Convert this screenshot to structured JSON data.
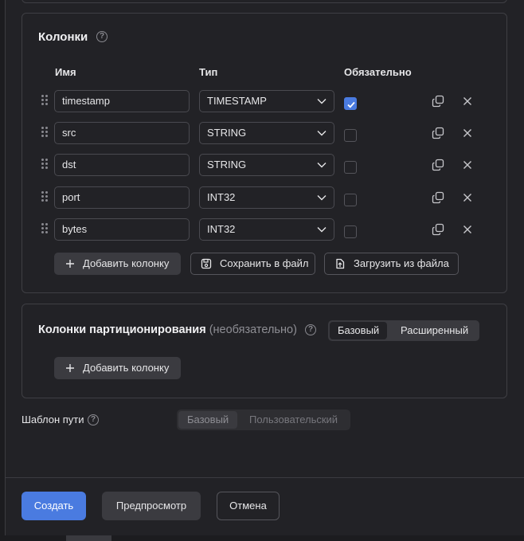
{
  "columns_section": {
    "title": "Колонки",
    "headers": {
      "name": "Имя",
      "type": "Тип",
      "required": "Обязательно"
    },
    "rows": [
      {
        "name": "timestamp",
        "type": "TIMESTAMP",
        "required": true
      },
      {
        "name": "src",
        "type": "STRING",
        "required": false
      },
      {
        "name": "dst",
        "type": "STRING",
        "required": false
      },
      {
        "name": "port",
        "type": "INT32",
        "required": false
      },
      {
        "name": "bytes",
        "type": "INT32",
        "required": false
      }
    ],
    "add_column": "Добавить колонку",
    "save_to_file": "Сохранить в файл",
    "load_from_file": "Загрузить из файла"
  },
  "partition_section": {
    "title": "Колонки партиционирования",
    "optional": "(необязательно)",
    "mode_options": [
      "Базовый",
      "Расширенный"
    ],
    "mode_selected": "Базовый",
    "add_column": "Добавить колонку"
  },
  "path_template": {
    "label": "Шаблон пути",
    "options": [
      "Базовый",
      "Пользовательский"
    ],
    "selected": "Базовый",
    "disabled": true
  },
  "footer": {
    "create": "Создать",
    "preview": "Предпросмотр",
    "cancel": "Отмена"
  },
  "colors": {
    "accent": "#4a7be0",
    "background": "#222226",
    "border": "#3f3f44"
  }
}
